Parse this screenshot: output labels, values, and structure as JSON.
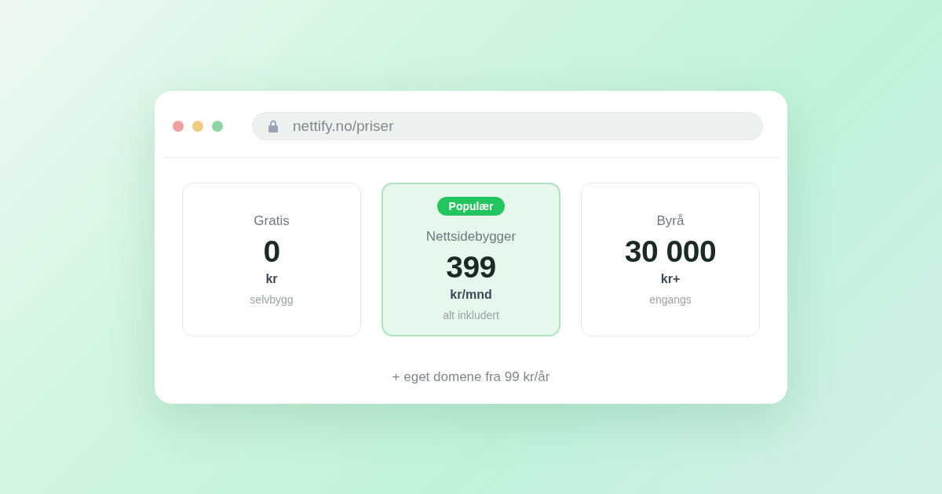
{
  "browser": {
    "window_controls": [
      {
        "color": "#f0a09c"
      },
      {
        "color": "#efcb80"
      },
      {
        "color": "#8fd4a5"
      }
    ],
    "address_bar": {
      "url": "nettify.no/priser"
    }
  },
  "plans": [
    {
      "name": "Gratis",
      "price": "0",
      "unit": "kr",
      "note": "selvbygg",
      "highlighted": false
    },
    {
      "badge": "Populær",
      "name": "Nettsidebygger",
      "price": "399",
      "unit": "kr/mnd",
      "note": "alt inkludert",
      "highlighted": true
    },
    {
      "name": "Byrå",
      "price": "30 000",
      "unit": "kr+",
      "note": "engangs",
      "highlighted": false
    }
  ],
  "footer_note": "+ eget domene fra 99 kr/år"
}
